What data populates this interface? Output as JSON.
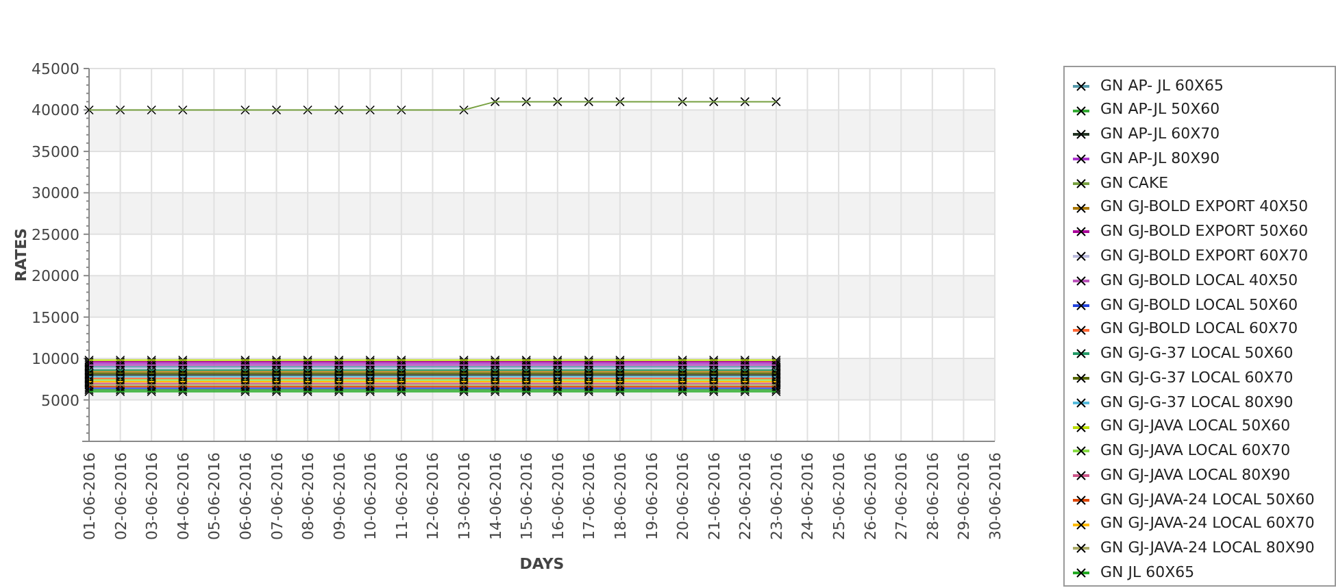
{
  "chart": {
    "chart_data": {
      "type": "line",
      "xlabel": "DAYS",
      "ylabel": "RATES",
      "grid": true,
      "categories": [
        "01-06-2016",
        "02-06-2016",
        "03-06-2016",
        "04-06-2016",
        "05-06-2016",
        "06-06-2016",
        "07-06-2016",
        "08-06-2016",
        "09-06-2016",
        "10-06-2016",
        "11-06-2016",
        "12-06-2016",
        "13-06-2016",
        "14-06-2016",
        "15-06-2016",
        "16-06-2016",
        "17-06-2016",
        "18-06-2016",
        "19-06-2016",
        "20-06-2016",
        "21-06-2016",
        "22-06-2016",
        "23-06-2016",
        "24-06-2016",
        "25-06-2016",
        "26-06-2016",
        "27-06-2016",
        "28-06-2016",
        "29-06-2016",
        "30-06-2016"
      ],
      "ylim": [
        0,
        45000
      ],
      "yticks": [
        5000,
        10000,
        15000,
        20000,
        25000,
        30000,
        35000,
        40000,
        45000
      ],
      "series": [
        {
          "name": "GN AP- JL 60X65",
          "color": "#5599aa",
          "marker": "x",
          "values": [
            9000,
            9000,
            9000,
            9000,
            null,
            9000,
            9000,
            9000,
            9000,
            9000,
            9000,
            null,
            9000,
            9000,
            9000,
            9000,
            9000,
            9000,
            null,
            9000,
            9000,
            9000,
            9000,
            null,
            null,
            null,
            null,
            null,
            null,
            null
          ]
        },
        {
          "name": "GN AP-JL 50X60",
          "color": "#33aa33",
          "marker": "x",
          "values": [
            6200,
            6200,
            6200,
            6200,
            null,
            6200,
            6200,
            6200,
            6200,
            6200,
            6200,
            null,
            6200,
            6200,
            6200,
            6200,
            6200,
            6200,
            null,
            6200,
            6200,
            6200,
            6200,
            null,
            null,
            null,
            null,
            null,
            null,
            null
          ]
        },
        {
          "name": "GN AP-JL 60X70",
          "color": "#223322",
          "marker": "x",
          "values": [
            8000,
            8000,
            8000,
            8000,
            null,
            8000,
            8000,
            8000,
            8000,
            8000,
            8000,
            null,
            8000,
            8000,
            8000,
            8000,
            8000,
            8000,
            null,
            8000,
            8000,
            8000,
            8000,
            null,
            null,
            null,
            null,
            null,
            null,
            null
          ]
        },
        {
          "name": "GN AP-JL 80X90",
          "color": "#aa33cc",
          "marker": "x",
          "values": [
            9400,
            9400,
            9400,
            9400,
            null,
            9400,
            9400,
            9400,
            9400,
            9400,
            9400,
            null,
            9400,
            9400,
            9400,
            9400,
            9400,
            9400,
            null,
            9400,
            9400,
            9400,
            9400,
            null,
            null,
            null,
            null,
            null,
            null,
            null
          ]
        },
        {
          "name": "GN CAKE",
          "color": "#77a040",
          "marker": "x",
          "values": [
            40000,
            40000,
            40000,
            40000,
            null,
            40000,
            40000,
            40000,
            40000,
            40000,
            40000,
            null,
            40000,
            41000,
            41000,
            41000,
            41000,
            41000,
            null,
            41000,
            41000,
            41000,
            41000,
            null,
            null,
            null,
            null,
            null,
            null,
            null
          ]
        },
        {
          "name": "GN GJ-BOLD EXPORT 40X50",
          "color": "#aa7700",
          "marker": "x",
          "values": [
            8400,
            8400,
            8400,
            8400,
            null,
            8400,
            8400,
            8400,
            8400,
            8400,
            8400,
            null,
            8400,
            8400,
            8400,
            8400,
            8400,
            8400,
            null,
            8400,
            8400,
            8400,
            8400,
            null,
            null,
            null,
            null,
            null,
            null,
            null
          ]
        },
        {
          "name": "GN GJ-BOLD EXPORT 50X60",
          "color": "#aa0099",
          "marker": "x",
          "values": [
            9600,
            9600,
            9600,
            9600,
            null,
            9600,
            9600,
            9600,
            9600,
            9600,
            9600,
            null,
            9600,
            9600,
            9600,
            9600,
            9600,
            9600,
            null,
            9600,
            9600,
            9600,
            9600,
            null,
            null,
            null,
            null,
            null,
            null,
            null
          ]
        },
        {
          "name": "GN GJ-BOLD EXPORT 60X70",
          "color": "#bbbbdd",
          "marker": "x",
          "values": [
            8800,
            8800,
            8800,
            8800,
            null,
            8800,
            8800,
            8800,
            8800,
            8800,
            8800,
            null,
            8800,
            8800,
            8800,
            8800,
            8800,
            8800,
            null,
            8800,
            8800,
            8800,
            8800,
            null,
            null,
            null,
            null,
            null,
            null,
            null
          ]
        },
        {
          "name": "GN GJ-BOLD LOCAL 40X50",
          "color": "#bb55bb",
          "marker": "x",
          "values": [
            9200,
            9200,
            9200,
            9200,
            null,
            9200,
            9200,
            9200,
            9200,
            9200,
            9200,
            null,
            9200,
            9200,
            9200,
            9200,
            9200,
            9200,
            null,
            9200,
            9200,
            9200,
            9200,
            null,
            null,
            null,
            null,
            null,
            null,
            null
          ]
        },
        {
          "name": "GN GJ-BOLD LOCAL 50X60",
          "color": "#2244dd",
          "marker": "x",
          "values": [
            6400,
            6400,
            6400,
            6400,
            null,
            6400,
            6400,
            6400,
            6400,
            6400,
            6400,
            null,
            6400,
            6400,
            6400,
            6400,
            6400,
            6400,
            null,
            6400,
            6400,
            6400,
            6400,
            null,
            null,
            null,
            null,
            null,
            null,
            null
          ]
        },
        {
          "name": "GN GJ-BOLD LOCAL 60X70",
          "color": "#ff6633",
          "marker": "x",
          "values": [
            7600,
            7600,
            7600,
            7600,
            null,
            7600,
            7600,
            7600,
            7600,
            7600,
            7600,
            null,
            7600,
            7600,
            7600,
            7600,
            7600,
            7600,
            null,
            7600,
            7600,
            7600,
            7600,
            null,
            null,
            null,
            null,
            null,
            null,
            null
          ]
        },
        {
          "name": "GN GJ-G-37 LOCAL 50X60",
          "color": "#229966",
          "marker": "x",
          "values": [
            8600,
            8600,
            8600,
            8600,
            null,
            8600,
            8600,
            8600,
            8600,
            8600,
            8600,
            null,
            8600,
            8600,
            8600,
            8600,
            8600,
            8600,
            null,
            8600,
            8600,
            8600,
            8600,
            null,
            null,
            null,
            null,
            null,
            null,
            null
          ]
        },
        {
          "name": "GN GJ-G-37 LOCAL 60X70",
          "color": "#556600",
          "marker": "x",
          "values": [
            8200,
            8200,
            8200,
            8200,
            null,
            8200,
            8200,
            8200,
            8200,
            8200,
            8200,
            null,
            8200,
            8200,
            8200,
            8200,
            8200,
            8200,
            null,
            8200,
            8200,
            8200,
            8200,
            null,
            null,
            null,
            null,
            null,
            null,
            null
          ]
        },
        {
          "name": "GN GJ-G-37 LOCAL 80X90",
          "color": "#55bbdd",
          "marker": "x",
          "values": [
            7800,
            7800,
            7800,
            7800,
            null,
            7800,
            7800,
            7800,
            7800,
            7800,
            7800,
            null,
            7800,
            7800,
            7800,
            7800,
            7800,
            7800,
            null,
            7800,
            7800,
            7800,
            7800,
            null,
            null,
            null,
            null,
            null,
            null,
            null
          ]
        },
        {
          "name": "GN GJ-JAVA LOCAL 50X60",
          "color": "#bbdd00",
          "marker": "x",
          "values": [
            9800,
            9800,
            9800,
            9800,
            null,
            9800,
            9800,
            9800,
            9800,
            9800,
            9800,
            null,
            9800,
            9800,
            9800,
            9800,
            9800,
            9800,
            null,
            9800,
            9800,
            9800,
            9800,
            null,
            null,
            null,
            null,
            null,
            null,
            null
          ]
        },
        {
          "name": "GN GJ-JAVA LOCAL 60X70",
          "color": "#88dd44",
          "marker": "x",
          "values": [
            7400,
            7400,
            7400,
            7400,
            null,
            7400,
            7400,
            7400,
            7400,
            7400,
            7400,
            null,
            7400,
            7400,
            7400,
            7400,
            7400,
            7400,
            null,
            7400,
            7400,
            7400,
            7400,
            null,
            null,
            null,
            null,
            null,
            null,
            null
          ]
        },
        {
          "name": "GN GJ-JAVA LOCAL 80X90",
          "color": "#cc5588",
          "marker": "x",
          "values": [
            7000,
            7000,
            7000,
            7000,
            null,
            7000,
            7000,
            7000,
            7000,
            7000,
            7000,
            null,
            7000,
            7000,
            7000,
            7000,
            7000,
            7000,
            null,
            7000,
            7000,
            7000,
            7000,
            null,
            null,
            null,
            null,
            null,
            null,
            null
          ]
        },
        {
          "name": "GN GJ-JAVA-24 LOCAL 50X60",
          "color": "#dd4400",
          "marker": "x",
          "values": [
            6600,
            6600,
            6600,
            6600,
            null,
            6600,
            6600,
            6600,
            6600,
            6600,
            6600,
            null,
            6600,
            6600,
            6600,
            6600,
            6600,
            6600,
            null,
            6600,
            6600,
            6600,
            6600,
            null,
            null,
            null,
            null,
            null,
            null,
            null
          ]
        },
        {
          "name": "GN GJ-JAVA-24 LOCAL 60X70",
          "color": "#ffbb00",
          "marker": "x",
          "values": [
            7200,
            7200,
            7200,
            7200,
            null,
            7200,
            7200,
            7200,
            7200,
            7200,
            7200,
            null,
            7200,
            7200,
            7200,
            7200,
            7200,
            7200,
            null,
            7200,
            7200,
            7200,
            7200,
            null,
            null,
            null,
            null,
            null,
            null,
            null
          ]
        },
        {
          "name": "GN GJ-JAVA-24 LOCAL 80X90",
          "color": "#aaaa66",
          "marker": "x",
          "values": [
            6800,
            6800,
            6800,
            6800,
            null,
            6800,
            6800,
            6800,
            6800,
            6800,
            6800,
            null,
            6800,
            6800,
            6800,
            6800,
            6800,
            6800,
            null,
            6800,
            6800,
            6800,
            6800,
            null,
            null,
            null,
            null,
            null,
            null,
            null
          ]
        },
        {
          "name": "GN JL 60X65",
          "color": "#22aa22",
          "marker": "x",
          "values": [
            6000,
            6000,
            6000,
            6000,
            null,
            6000,
            6000,
            6000,
            6000,
            6000,
            6000,
            null,
            6000,
            6000,
            6000,
            6000,
            6000,
            6000,
            null,
            6000,
            6000,
            6000,
            6000,
            null,
            null,
            null,
            null,
            null,
            null,
            null
          ]
        }
      ]
    }
  }
}
